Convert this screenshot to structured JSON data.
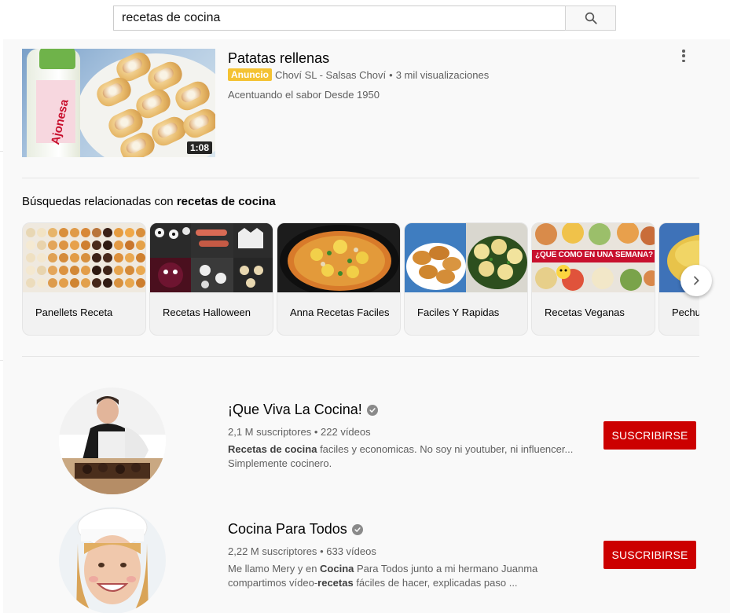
{
  "search": {
    "query": "recetas de cocina"
  },
  "ad": {
    "title": "Patatas rellenas",
    "badge": "Anuncio",
    "advertiser": "Choví SL - Salsas Choví",
    "separator": "•",
    "views": "3 mil visualizaciones",
    "description": "Acentuando el sabor Desde 1950",
    "duration": "1:08",
    "bottle_text": "Ajonesa"
  },
  "related": {
    "heading_prefix": "Búsquedas relacionadas con ",
    "heading_query": "recetas de cocina",
    "items": [
      {
        "label": "Panellets Receta"
      },
      {
        "label": "Recetas Halloween"
      },
      {
        "label": "Anna Recetas Faciles"
      },
      {
        "label": "Faciles Y Rapidas"
      },
      {
        "label": "Recetas Veganas"
      },
      {
        "label": "Pechu"
      }
    ],
    "veganas_overlay": "¿QUE COMO EN UNA SEMANA?"
  },
  "channels": [
    {
      "name": "¡Que Viva La Cocina!",
      "subscribers": "2,1 M suscriptores",
      "separator": "•",
      "videos": "222 vídeos",
      "desc_line1_bold": "Recetas de cocina",
      "desc_line1_rest": " faciles y economicas. No soy ni youtuber, ni influencer...",
      "desc_line2": "Simplemente cocinero.",
      "subscribe_label": "SUSCRIBIRSE"
    },
    {
      "name": "Cocina Para Todos",
      "subscribers": "2,22 M suscriptores",
      "separator": "•",
      "videos": "633 vídeos",
      "desc_line1_a": "Me llamo Mery y en ",
      "desc_line1_bold": "Cocina",
      "desc_line1_b": " Para Todos junto a mi hermano Juanma",
      "desc_line2_a": "compartimos vídeo-",
      "desc_line2_bold": "recetas",
      "desc_line2_b": " fáciles de hacer, explicadas paso ...",
      "subscribe_label": "SUSCRIBIRSE"
    }
  ],
  "icons": {
    "search": "search-icon",
    "more": "more-vert-icon",
    "next": "chevron-right-icon",
    "verified": "verified-check-icon"
  },
  "colors": {
    "subscribe": "#cc0000",
    "ad_badge": "#f4c233",
    "background": "#f9f9f9",
    "secondary_text": "#606060"
  }
}
